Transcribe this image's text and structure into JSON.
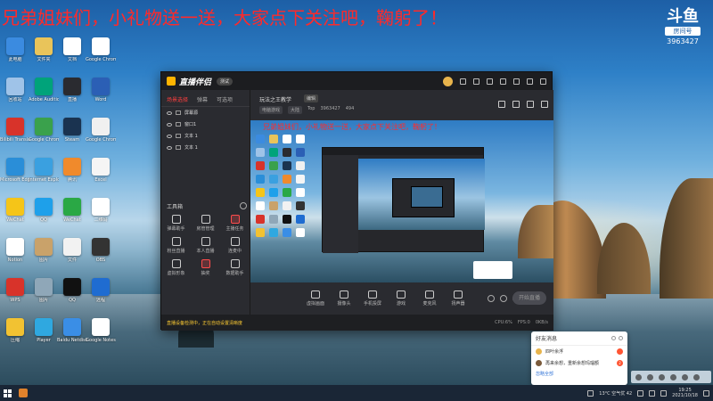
{
  "stream": {
    "banner": "兄弟姐妹们，小礼物送一送，大家点下关注吧，鞠躬了！",
    "logo": "斗鱼",
    "room_label": "房间号",
    "room_number": "3963427"
  },
  "desktop": {
    "icons": [
      {
        "label": "此电脑",
        "color": "#3b8be0"
      },
      {
        "label": "文件夹",
        "color": "#e9c45a"
      },
      {
        "label": "文档",
        "color": "#ffffff"
      },
      {
        "label": "Google Chrome",
        "color": "#ffffff"
      },
      {
        "label": "回收站",
        "color": "#9fc3e8"
      },
      {
        "label": "Adobe Audition",
        "color": "#00a37a"
      },
      {
        "label": "直播",
        "color": "#2a2b30"
      },
      {
        "label": "Word",
        "color": "#2b5fb5"
      },
      {
        "label": "Bilibili Translator",
        "color": "#d8332a"
      },
      {
        "label": "Google Chrome",
        "color": "#3aa14c"
      },
      {
        "label": "Steam",
        "color": "#1a3350"
      },
      {
        "label": "Google Chrome",
        "color": "#f0f0f0"
      },
      {
        "label": "Microsoft Edge",
        "color": "#2a8ed8"
      },
      {
        "label": "Internet Explorer",
        "color": "#3aa0e0"
      },
      {
        "label": "腾讯",
        "color": "#f08a2c"
      },
      {
        "label": "Excel",
        "color": "#f5f5f5"
      },
      {
        "label": "WeChat",
        "color": "#f5c518"
      },
      {
        "label": "QQ",
        "color": "#1ea0ea"
      },
      {
        "label": "WeChat",
        "color": "#2aa845"
      },
      {
        "label": "二维码",
        "color": "#ffffff"
      },
      {
        "label": "Notion",
        "color": "#ffffff"
      },
      {
        "label": "图片",
        "color": "#c9a26a"
      },
      {
        "label": "文件",
        "color": "#f2f2f2"
      },
      {
        "label": "OBS",
        "color": "#333333"
      },
      {
        "label": "WPS",
        "color": "#d8332a"
      },
      {
        "label": "图片",
        "color": "#8fa7b8"
      },
      {
        "label": "QQ",
        "color": "#111111"
      },
      {
        "label": "远程",
        "color": "#1f6cd1"
      },
      {
        "label": "压缩",
        "color": "#f2c232"
      },
      {
        "label": "Player",
        "color": "#2fa8e0"
      },
      {
        "label": "Baidu Netdisk",
        "color": "#3a8ee6"
      },
      {
        "label": "Google Notes",
        "color": "#ffffff"
      }
    ]
  },
  "app": {
    "brand": "直播伴侣",
    "version": "测试",
    "left_tabs": [
      "场景选择",
      "弹幕",
      "可选项"
    ],
    "scenes": [
      {
        "label": "屏幕源"
      },
      {
        "label": "窗口1"
      },
      {
        "label": "文本 1"
      },
      {
        "label": "文本 1"
      }
    ],
    "tools_title": "工具箱",
    "tools": [
      {
        "label": "弹幕助手",
        "red": false
      },
      {
        "label": "房管管理",
        "red": false
      },
      {
        "label": "主播任务",
        "red": true
      },
      {
        "label": "粉丝直播",
        "red": false
      },
      {
        "label": "本人直播",
        "red": false
      },
      {
        "label": "连麦中",
        "red": false
      },
      {
        "label": "虚拟形象",
        "red": false
      },
      {
        "label": "抽奖",
        "red": true
      },
      {
        "label": "数据助手",
        "red": false
      }
    ],
    "room_title": "玩法之王教学",
    "edit_label": "编辑",
    "category_chip": "电脑游戏",
    "category_chip2": "大陆",
    "meta_text": "Top",
    "meta_room": "3963427",
    "meta_hot": "494",
    "preview_banner": "兄弟姐妹们，小礼物送一送，大家点下关注吧，鞠躬了！",
    "actions": [
      {
        "label": "虚拟画面"
      },
      {
        "label": "摄像头"
      },
      {
        "label": "手机投屏"
      },
      {
        "label": "游戏"
      },
      {
        "label": "麦克风"
      },
      {
        "label": "扬声器"
      }
    ],
    "go_live": "开始直播",
    "status_warn": "直播设备检测中，正在自动设置清晰度",
    "status_cpu": "CPU:6%",
    "status_fps": "FPS:0",
    "status_bitrate": "0KB/s"
  },
  "notification": {
    "title": "好友消息",
    "rows": [
      {
        "text": "四叶余浮",
        "badge": "",
        "avatar_color": "#e8b44c"
      },
      {
        "text": "再来余想，重新余想玛瑙额",
        "badge": "2",
        "avatar_color": "#7a5a3a"
      }
    ],
    "footer": "忽略全部"
  },
  "taskbar": {
    "weather": "13°C 空气优 42",
    "time": "19:25",
    "date": "2021/10/18"
  }
}
